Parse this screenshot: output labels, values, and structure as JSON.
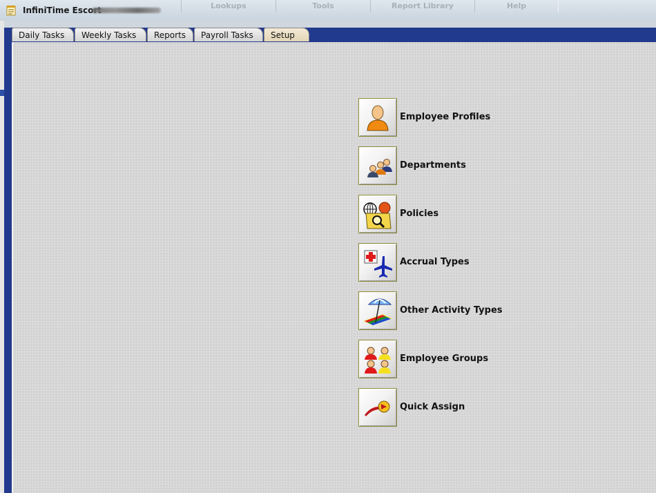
{
  "window": {
    "title": "InfiniTime Escort"
  },
  "top_menu": [
    "Lookups",
    "Tools",
    "Report Library",
    "Help"
  ],
  "tabs": [
    "Daily Tasks",
    "Weekly Tasks",
    "Reports",
    "Payroll Tasks",
    "Setup"
  ],
  "active_tab": "Setup",
  "setup_items": [
    {
      "label": "Employee Profiles",
      "icon": "person-icon"
    },
    {
      "label": "Departments",
      "icon": "people-group-icon"
    },
    {
      "label": "Policies",
      "icon": "policy-folder-icon"
    },
    {
      "label": "Accrual Types",
      "icon": "medical-airplane-icon"
    },
    {
      "label": "Other Activity Types",
      "icon": "beach-umbrella-icon"
    },
    {
      "label": "Employee Groups",
      "icon": "employee-groups-icon"
    },
    {
      "label": "Quick Assign",
      "icon": "quick-assign-icon"
    }
  ],
  "colors": {
    "band": "#223a8d",
    "panel": "#d3d3d3",
    "active_tab": "#e4d6b6"
  }
}
